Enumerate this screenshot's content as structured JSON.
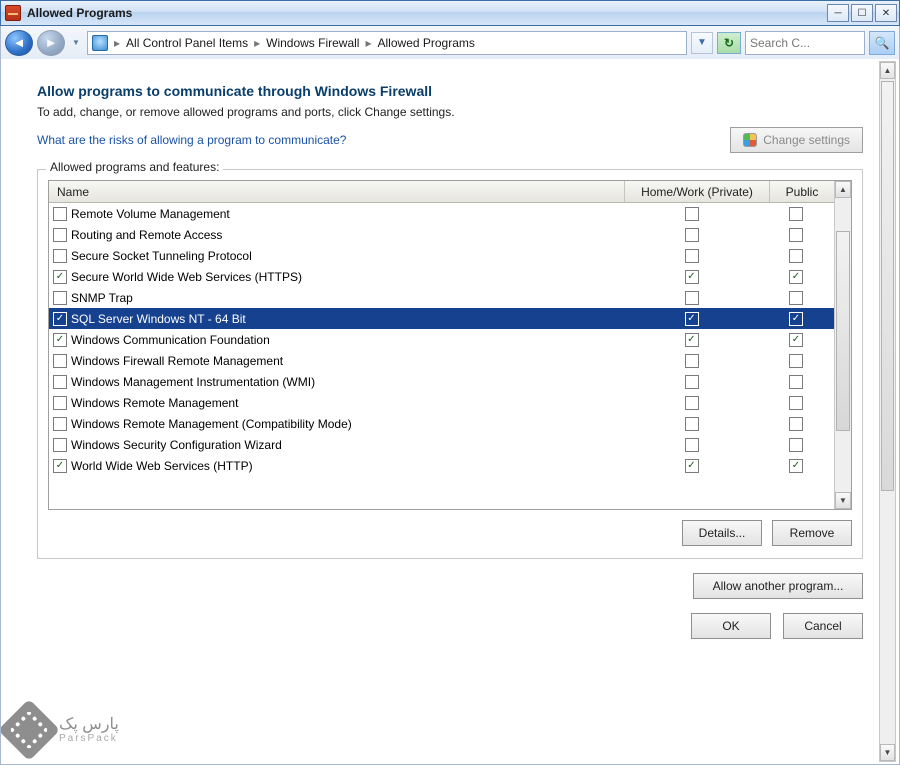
{
  "window": {
    "title": "Allowed Programs"
  },
  "breadcrumb": {
    "item0": "All Control Panel Items",
    "item1": "Windows Firewall",
    "item2": "Allowed Programs"
  },
  "search": {
    "placeholder": "Search C..."
  },
  "page": {
    "heading": "Allow programs to communicate through Windows Firewall",
    "subtext": "To add, change, or remove allowed programs and ports, click Change settings.",
    "risk_link": "What are the risks of allowing a program to communicate?",
    "change_settings": "Change settings"
  },
  "group": {
    "label": "Allowed programs and features:",
    "cols": {
      "name": "Name",
      "hw": "Home/Work (Private)",
      "pub": "Public"
    },
    "details": "Details...",
    "remove": "Remove"
  },
  "rows": [
    {
      "name": "Remote Volume Management",
      "name_ck": false,
      "hw": false,
      "pub": false,
      "sel": false
    },
    {
      "name": "Routing and Remote Access",
      "name_ck": false,
      "hw": false,
      "pub": false,
      "sel": false
    },
    {
      "name": "Secure Socket Tunneling Protocol",
      "name_ck": false,
      "hw": false,
      "pub": false,
      "sel": false
    },
    {
      "name": "Secure World Wide Web Services (HTTPS)",
      "name_ck": true,
      "hw": true,
      "pub": true,
      "sel": false
    },
    {
      "name": "SNMP Trap",
      "name_ck": false,
      "hw": false,
      "pub": false,
      "sel": false
    },
    {
      "name": "SQL Server Windows NT - 64 Bit",
      "name_ck": true,
      "hw": true,
      "pub": true,
      "sel": true
    },
    {
      "name": "Windows Communication Foundation",
      "name_ck": true,
      "hw": true,
      "pub": true,
      "sel": false
    },
    {
      "name": "Windows Firewall Remote Management",
      "name_ck": false,
      "hw": false,
      "pub": false,
      "sel": false
    },
    {
      "name": "Windows Management Instrumentation (WMI)",
      "name_ck": false,
      "hw": false,
      "pub": false,
      "sel": false
    },
    {
      "name": "Windows Remote Management",
      "name_ck": false,
      "hw": false,
      "pub": false,
      "sel": false
    },
    {
      "name": "Windows Remote Management (Compatibility Mode)",
      "name_ck": false,
      "hw": false,
      "pub": false,
      "sel": false
    },
    {
      "name": "Windows Security Configuration Wizard",
      "name_ck": false,
      "hw": false,
      "pub": false,
      "sel": false
    },
    {
      "name": "World Wide Web Services (HTTP)",
      "name_ck": true,
      "hw": true,
      "pub": true,
      "sel": false
    }
  ],
  "actions": {
    "allow_another": "Allow another program...",
    "ok": "OK",
    "cancel": "Cancel"
  },
  "watermark": {
    "top": "پارس پک",
    "bottom": "ParsPack"
  }
}
